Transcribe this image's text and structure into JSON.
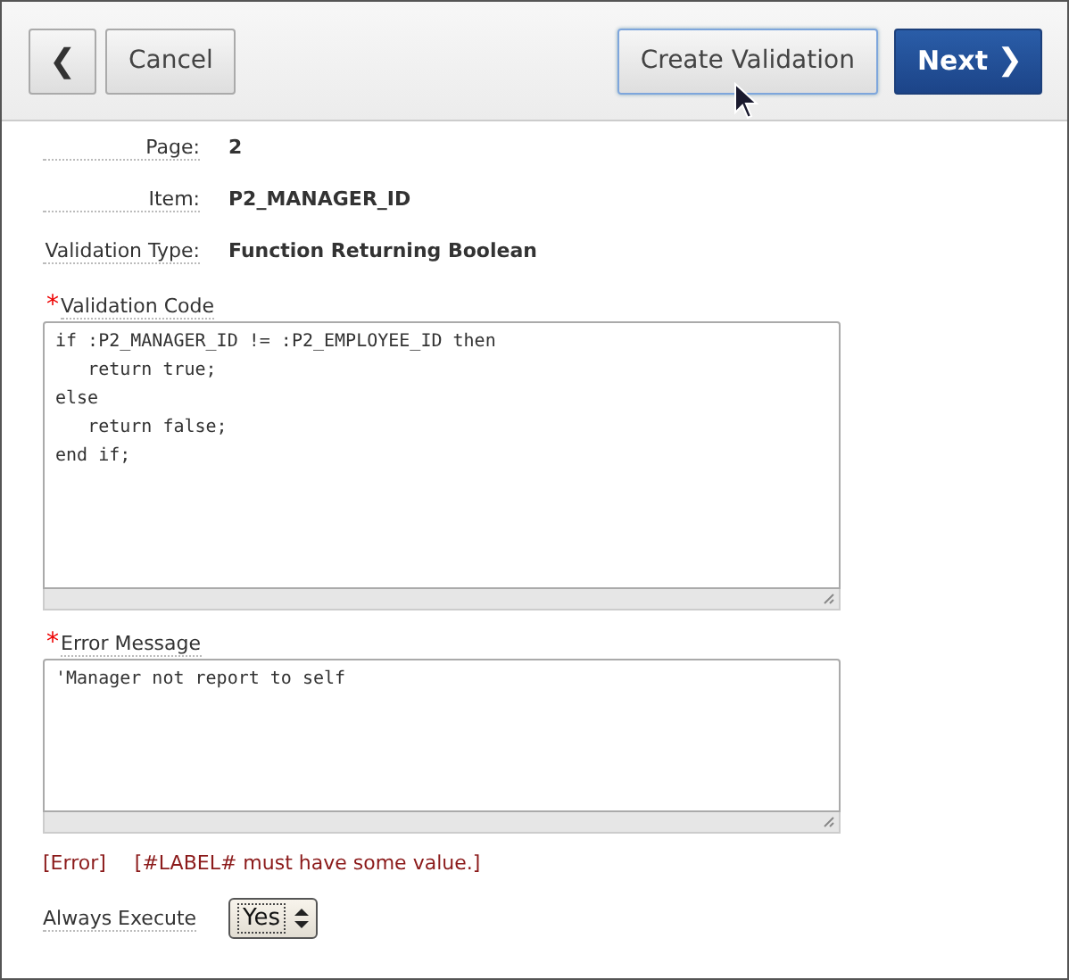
{
  "toolbar": {
    "back_button": {
      "label": "❮"
    },
    "cancel_button": {
      "label": "Cancel"
    },
    "create_button": {
      "label": "Create Validation",
      "focused": true
    },
    "next_button": {
      "label": "Next",
      "icon": "❯"
    }
  },
  "details": [
    {
      "label": "Page:",
      "value": "2"
    },
    {
      "label": "Item:",
      "value": "P2_MANAGER_ID"
    },
    {
      "label": "Validation Type:",
      "value": "Function Returning Boolean"
    }
  ],
  "validation_code": {
    "label": "Validation Code",
    "required": true,
    "required_mark": "*",
    "value": "if :P2_MANAGER_ID != :P2_EMPLOYEE_ID then\n   return true;\nelse\n   return false;\nend if;"
  },
  "error_message": {
    "label": "Error Message",
    "required": true,
    "required_mark": "*",
    "value": "'Manager not report to self"
  },
  "error": {
    "tag": "[Error]",
    "text": "[#LABEL# must have some value.]"
  },
  "always_execute": {
    "label": "Always Execute",
    "value": "Yes"
  }
}
